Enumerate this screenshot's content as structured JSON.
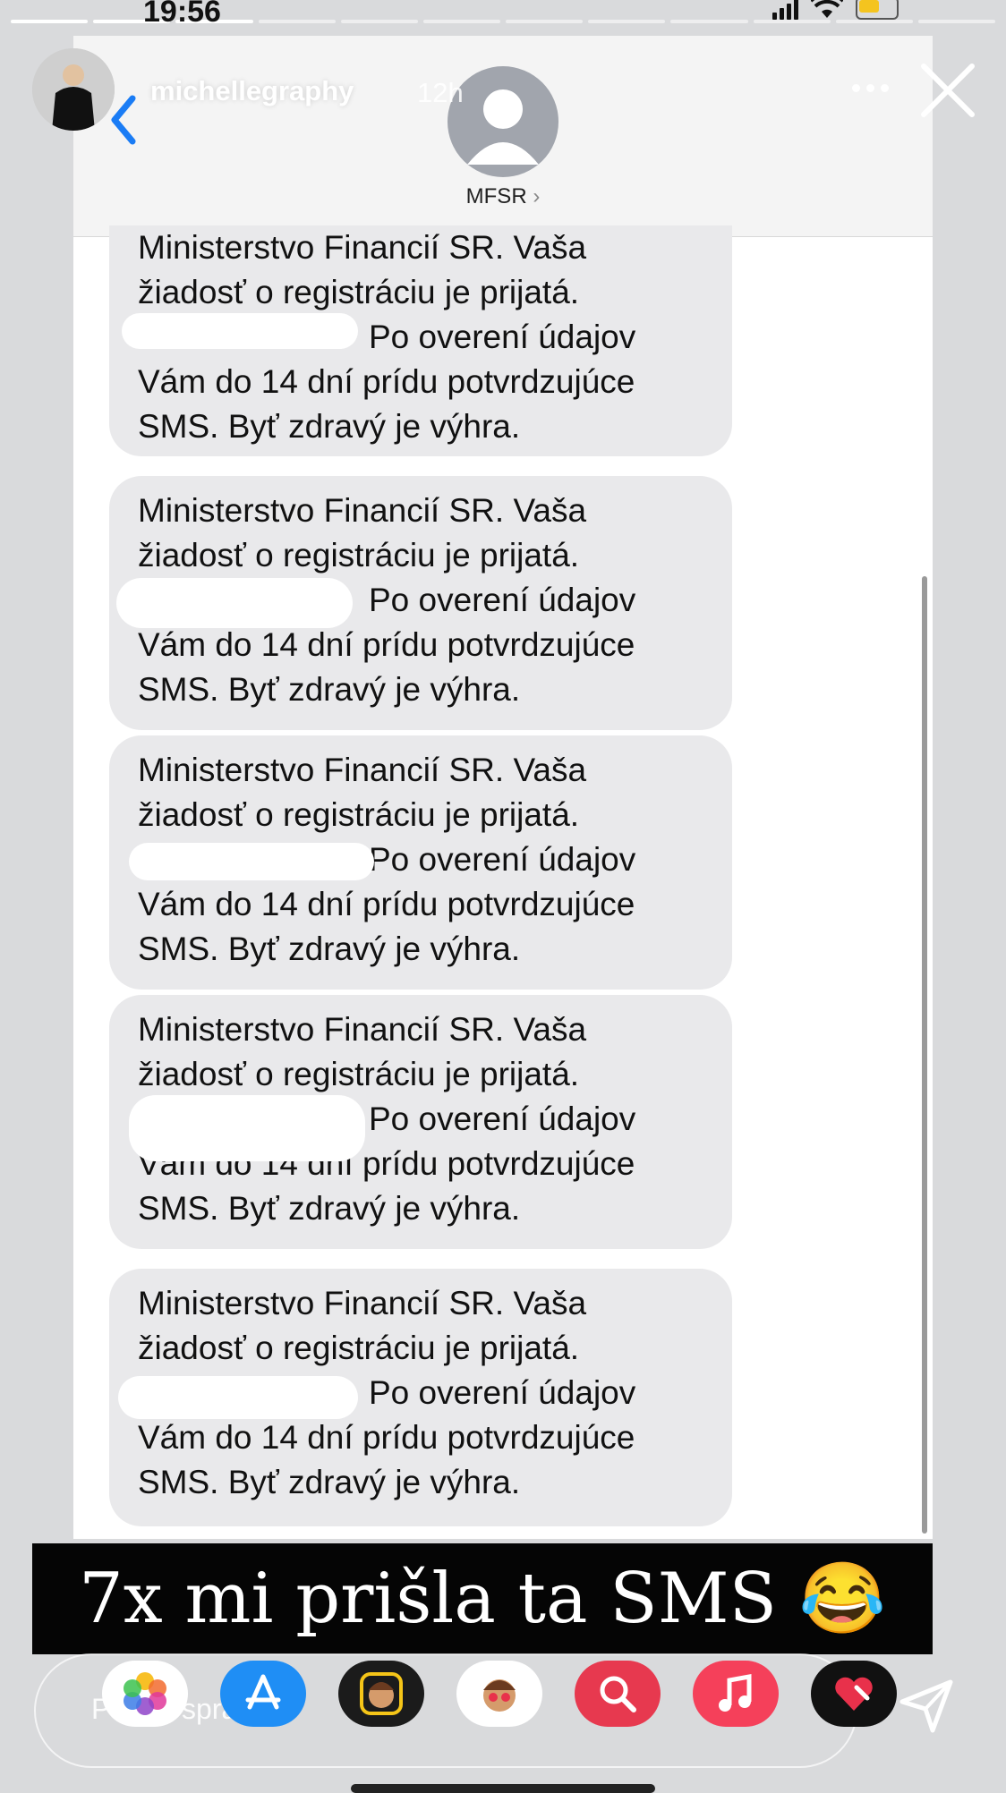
{
  "status_bar": {
    "time": "19:56",
    "story_segments": 12,
    "active_segment": 3
  },
  "story": {
    "username": "michellegraphy",
    "time_ago": "12h"
  },
  "sms": {
    "contact_name": "MFSR",
    "messages": [
      {
        "line1": "Ministerstvo Financií SR. Vaša",
        "line2": "žiadosť o registráciu je prijatá.",
        "line3": "Po overení údajov",
        "line4": "Vám do 14 dní prídu potvrdzujúce",
        "line5": "SMS. Byť zdravý je výhra."
      },
      {
        "line1": "Ministerstvo Financií SR. Vaša",
        "line2": "žiadosť o registráciu je prijatá.",
        "line3": "Po overení údajov",
        "line4": "Vám do 14 dní prídu potvrdzujúce",
        "line5": "SMS. Byť zdravý je výhra."
      },
      {
        "line1": "Ministerstvo Financií SR. Vaša",
        "line2": "žiadosť o registráciu je prijatá.",
        "line3": "Po overení údajov",
        "line4": "Vám do 14 dní prídu potvrdzujúce",
        "line5": "SMS. Byť zdravý je výhra."
      },
      {
        "line1": "Ministerstvo Financií SR. Vaša",
        "line2": "žiadosť o registráciu je prijatá.",
        "line3": "Po overení údajov",
        "line4": "Vám do 14 dní prídu potvrdzujúce",
        "line5": "SMS. Byť zdravý je výhra."
      },
      {
        "line1": "Ministerstvo Financií SR. Vaša",
        "line2": "žiadosť o registráciu je prijatá.",
        "line3": "Po overení údajov",
        "line4": "Vám do 14 dní prídu potvrdzujúce",
        "line5": "SMS. Byť zdravý je výhra."
      }
    ]
  },
  "caption": {
    "text": "7x mi prišla ta SMS 😂"
  },
  "reply": {
    "placeholder": "Poslať správu"
  },
  "apps": [
    {
      "name": "photos-icon",
      "color": "#ffffff"
    },
    {
      "name": "app-store-icon",
      "color": "#1f8ef5"
    },
    {
      "name": "memoji-icon",
      "color": "#1b1b1b"
    },
    {
      "name": "memoji-stickers-icon",
      "color": "#ffffff"
    },
    {
      "name": "web-search-icon",
      "color": "#e7394f"
    },
    {
      "name": "music-icon",
      "color": "#f5405a"
    },
    {
      "name": "digital-touch-icon",
      "color": "#111111"
    }
  ]
}
